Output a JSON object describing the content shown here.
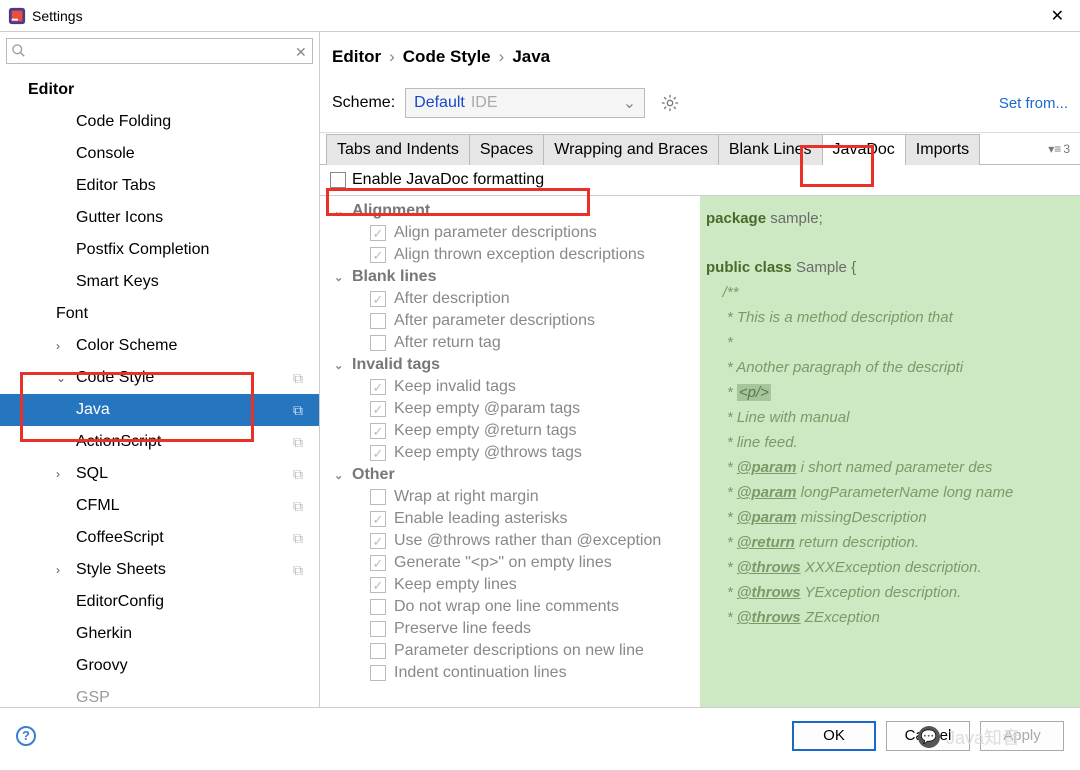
{
  "window": {
    "title": "Settings"
  },
  "search": {
    "placeholder": ""
  },
  "sidebar": {
    "editor_label": "Editor",
    "items_lvl1": [
      "Code Folding",
      "Console",
      "Editor Tabs",
      "Gutter Icons",
      "Postfix Completion",
      "Smart Keys"
    ],
    "font_label": "Font",
    "color_scheme_label": "Color Scheme",
    "code_style_label": "Code Style",
    "code_style_children": [
      "Java",
      "ActionScript",
      "SQL",
      "CFML",
      "CoffeeScript",
      "Style Sheets",
      "EditorConfig",
      "Gherkin",
      "Groovy",
      "GSP"
    ]
  },
  "breadcrumb": {
    "a": "Editor",
    "b": "Code Style",
    "c": "Java"
  },
  "scheme": {
    "label": "Scheme:",
    "name": "Default",
    "suffix": "IDE",
    "setfrom": "Set from..."
  },
  "tabs": [
    "Tabs and Indents",
    "Spaces",
    "Wrapping and Braces",
    "Blank Lines",
    "JavaDoc",
    "Imports"
  ],
  "tabs_counter": "3",
  "enable_label": "Enable JavaDoc formatting",
  "sections": {
    "alignment": {
      "title": "Alignment",
      "items": [
        {
          "label": "Align parameter descriptions",
          "checked": true
        },
        {
          "label": "Align thrown exception descriptions",
          "checked": true
        }
      ]
    },
    "blank": {
      "title": "Blank lines",
      "items": [
        {
          "label": "After description",
          "checked": true
        },
        {
          "label": "After parameter descriptions",
          "checked": false
        },
        {
          "label": "After return tag",
          "checked": false
        }
      ]
    },
    "invalid": {
      "title": "Invalid tags",
      "items": [
        {
          "label": "Keep invalid tags",
          "checked": true
        },
        {
          "label": "Keep empty @param tags",
          "checked": true
        },
        {
          "label": "Keep empty @return tags",
          "checked": true
        },
        {
          "label": "Keep empty @throws tags",
          "checked": true
        }
      ]
    },
    "other": {
      "title": "Other",
      "items": [
        {
          "label": "Wrap at right margin",
          "checked": false
        },
        {
          "label": "Enable leading asterisks",
          "checked": true
        },
        {
          "label": "Use @throws rather than @exception",
          "checked": true
        },
        {
          "label": "Generate \"<p>\" on empty lines",
          "checked": true
        },
        {
          "label": "Keep empty lines",
          "checked": true
        },
        {
          "label": "Do not wrap one line comments",
          "checked": false
        },
        {
          "label": "Preserve line feeds",
          "checked": false
        },
        {
          "label": "Parameter descriptions on new line",
          "checked": false
        },
        {
          "label": "Indent continuation lines",
          "checked": false
        }
      ]
    }
  },
  "preview": {
    "l1a": "package",
    "l1b": " sample;",
    "l2a": "public class",
    "l2b": " Sample {",
    "c1": "    /**",
    "c2": "     * This is a method description that",
    "c3": "     *",
    "c4": "     * Another paragraph of the descripti",
    "c5a": "     * ",
    "c5b": "<p/>",
    "c6": "     * Line with manual",
    "c7": "     * line feed.",
    "c8a": "     * ",
    "c8t": "@param",
    "c8b": " i short named parameter des",
    "c9a": "     * ",
    "c9t": "@param",
    "c9b": " longParameterName long name",
    "c10a": "     * ",
    "c10t": "@param",
    "c10b": " missingDescription",
    "c11a": "     * ",
    "c11t": "@return",
    "c11b": " return description.",
    "c12a": "     * ",
    "c12t": "@throws",
    "c12b": " XXXException description.",
    "c13a": "     * ",
    "c13t": "@throws",
    "c13b": " YException description.",
    "c14a": "     * ",
    "c14t": "@throws",
    "c14b": " ZException"
  },
  "footer": {
    "ok": "OK",
    "cancel": "Cancel",
    "apply": "Apply"
  },
  "watermark": "Java知音"
}
